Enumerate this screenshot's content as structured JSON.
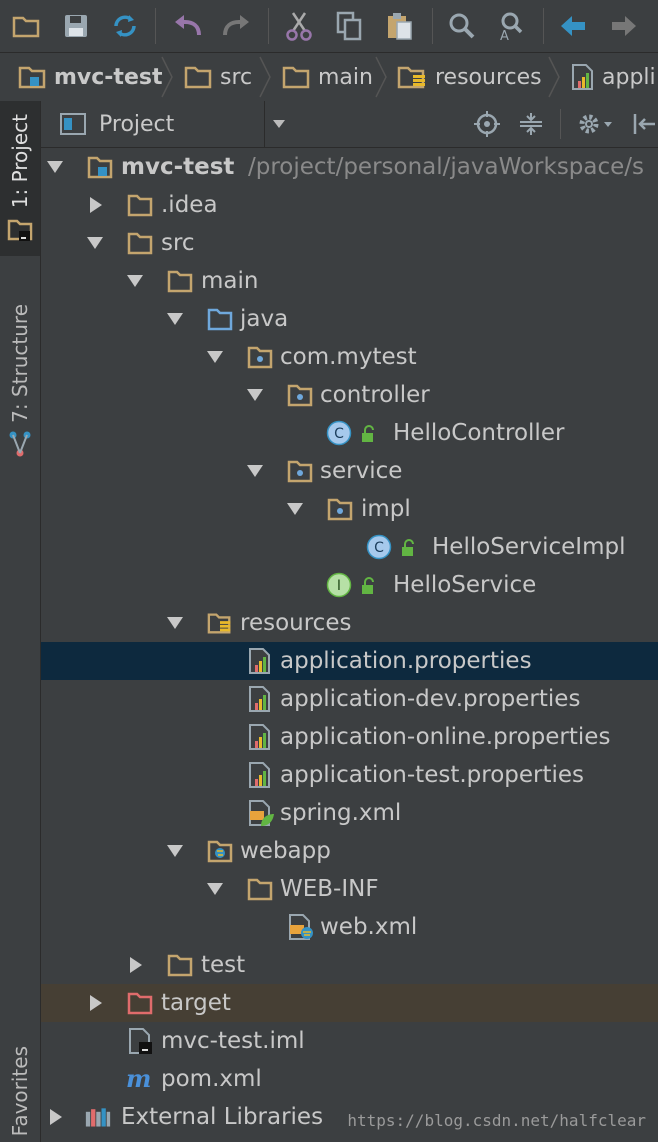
{
  "toolbar": {
    "icons": [
      "open-folder-icon",
      "save-icon",
      "sync-icon",
      "undo-icon",
      "redo-icon",
      "cut-icon",
      "copy-icon",
      "paste-icon",
      "find-icon",
      "replace-icon",
      "back-icon",
      "forward-icon"
    ]
  },
  "breadcrumb": {
    "items": [
      {
        "label": "mvc-test",
        "icon": "module-folder-icon"
      },
      {
        "label": "src",
        "icon": "folder-icon"
      },
      {
        "label": "main",
        "icon": "folder-icon"
      },
      {
        "label": "resources",
        "icon": "resources-folder-icon"
      },
      {
        "label": "appli",
        "icon": "properties-file-icon"
      }
    ]
  },
  "side_tabs": {
    "project": "1: Project",
    "structure": "7: Structure",
    "favorites": "Favorites"
  },
  "project_panel": {
    "view_label": "Project"
  },
  "tree": {
    "root_label": "mvc-test",
    "root_path": "/project/personal/javaWorkspace/s",
    "idea": ".idea",
    "src": "src",
    "main": "main",
    "java": "java",
    "pkg": "com.mytest",
    "controller": "controller",
    "hello_controller": "HelloController",
    "service": "service",
    "impl": "impl",
    "hello_service_impl": "HelloServiceImpl",
    "hello_service": "HelloService",
    "resources": "resources",
    "app_props": "application.properties",
    "app_dev_props": "application-dev.properties",
    "app_online_props": "application-online.properties",
    "app_test_props": "application-test.properties",
    "spring_xml": "spring.xml",
    "webapp": "webapp",
    "web_inf": "WEB-INF",
    "web_xml": "web.xml",
    "test": "test",
    "target": "target",
    "iml": "mvc-test.iml",
    "pom": "pom.xml",
    "ext_libs": "External Libraries"
  },
  "class_badge": "C",
  "interface_badge": "I",
  "watermark": "https://blog.csdn.net/halfclear",
  "colors": {
    "background": "#3c3f41",
    "selection": "#0d293e",
    "excluded_row": "#463f34",
    "folder": "#c4a56e",
    "source_folder": "#6fa8dc",
    "excluded_folder": "#e06c6c"
  }
}
